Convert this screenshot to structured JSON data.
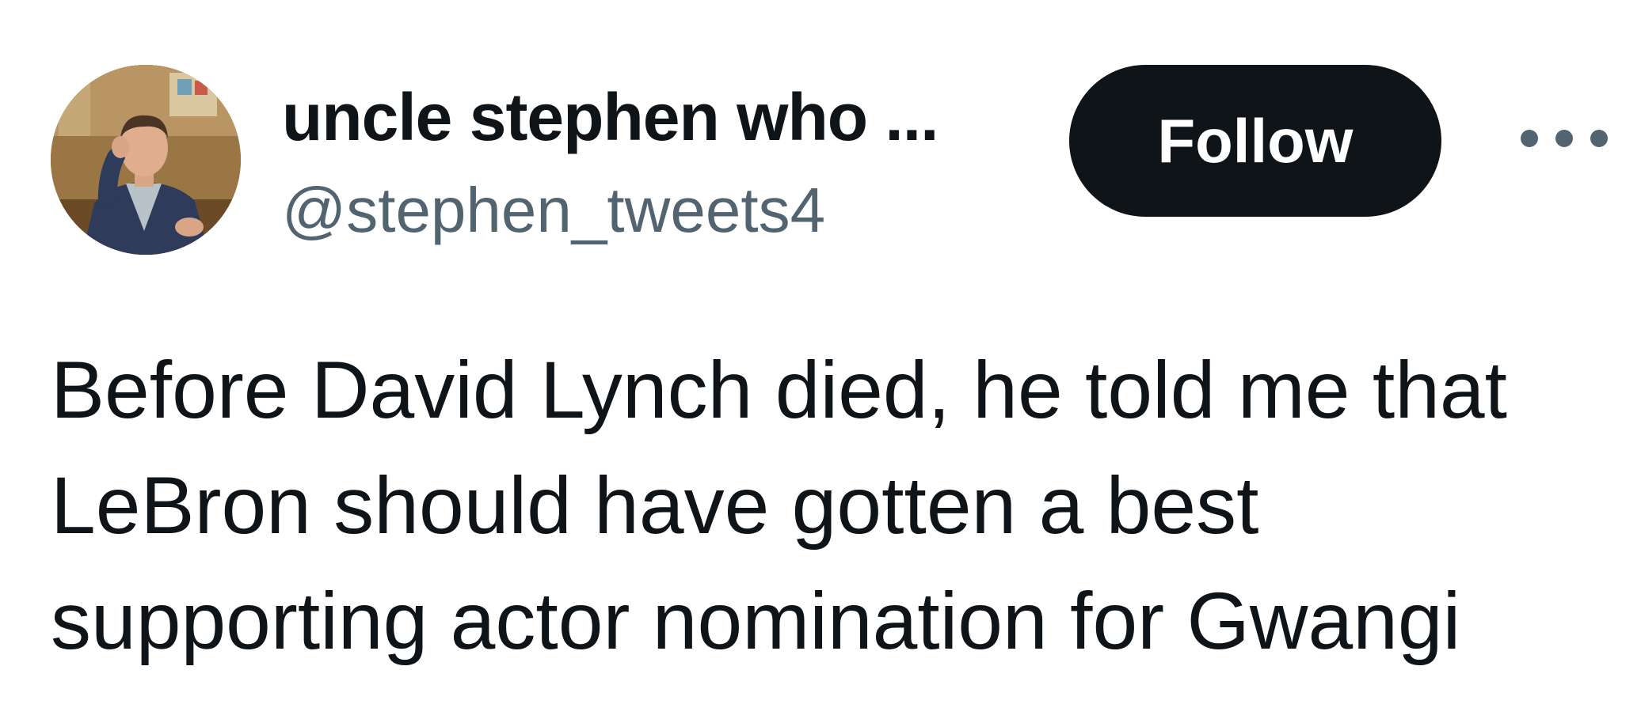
{
  "author": {
    "display_name": "uncle stephen who ...",
    "handle": "@stephen_tweets4",
    "avatar_icon": "profile-photo-avatar"
  },
  "actions": {
    "follow_label": "Follow",
    "more_icon": "more-horizontal-icon"
  },
  "tweet": {
    "lines": [
      "Before David Lynch died, he told me that",
      "LeBron should have gotten a best",
      "supporting actor nomination for Gwangi"
    ]
  },
  "colors": {
    "text_primary": "#0f1419",
    "text_secondary": "#536471",
    "button_bg": "#0f1419",
    "button_text": "#ffffff",
    "background": "#ffffff"
  }
}
